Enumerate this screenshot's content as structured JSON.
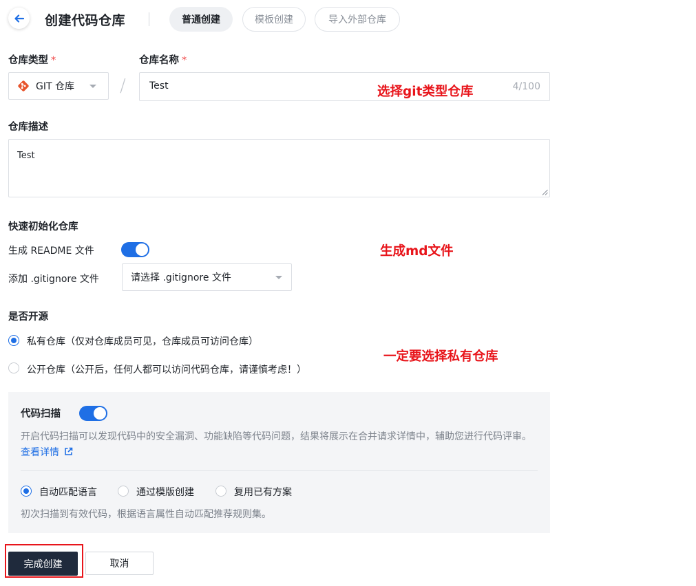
{
  "header": {
    "title": "创建代码仓库",
    "tabs": [
      {
        "label": "普通创建",
        "active": true
      },
      {
        "label": "模板创建",
        "active": false
      },
      {
        "label": "导入外部仓库",
        "active": false
      }
    ]
  },
  "form": {
    "repo_type": {
      "label": "仓库类型",
      "required_mark": "*",
      "value": "GIT 仓库",
      "icon": "git-icon"
    },
    "repo_name": {
      "label": "仓库名称",
      "required_mark": "*",
      "value": "Test",
      "counter": "4/100"
    },
    "description": {
      "label": "仓库描述",
      "value": "Test"
    },
    "quick_init": {
      "title": "快速初始化仓库",
      "readme": {
        "label": "生成 README 文件",
        "enabled": true
      },
      "gitignore": {
        "label": "添加 .gitignore 文件",
        "placeholder": "请选择 .gitignore 文件"
      }
    },
    "open_source": {
      "title": "是否开源",
      "options": [
        {
          "label": "私有仓库（仅对仓库成员可见，仓库成员可访问仓库）",
          "selected": true
        },
        {
          "label": "公开仓库（公开后，任何人都可以访问代码仓库，请谨慎考虑！）",
          "selected": false
        }
      ]
    },
    "code_scan": {
      "title": "代码扫描",
      "enabled": true,
      "description": "开启代码扫描可以发现代码中的安全漏洞、功能缺陷等代码问题，结果将展示在合并请求详情中，辅助您进行代码评审。",
      "link_text": "查看详情",
      "modes": [
        {
          "label": "自动匹配语言",
          "selected": true
        },
        {
          "label": "通过模版创建",
          "selected": false
        },
        {
          "label": "复用已有方案",
          "selected": false
        }
      ],
      "mode_hint": "初次扫描到有效代码，根据语言属性自动匹配推荐规则集。"
    }
  },
  "actions": {
    "submit": "完成创建",
    "cancel": "取消"
  },
  "annotations": {
    "git_type": "选择git类型仓库",
    "md_file": "生成md文件",
    "private": "一定要选择私有仓库"
  },
  "colors": {
    "accent": "#1f6fe5",
    "annotation": "#e8151b",
    "primary_button": "#1f2a3c"
  }
}
